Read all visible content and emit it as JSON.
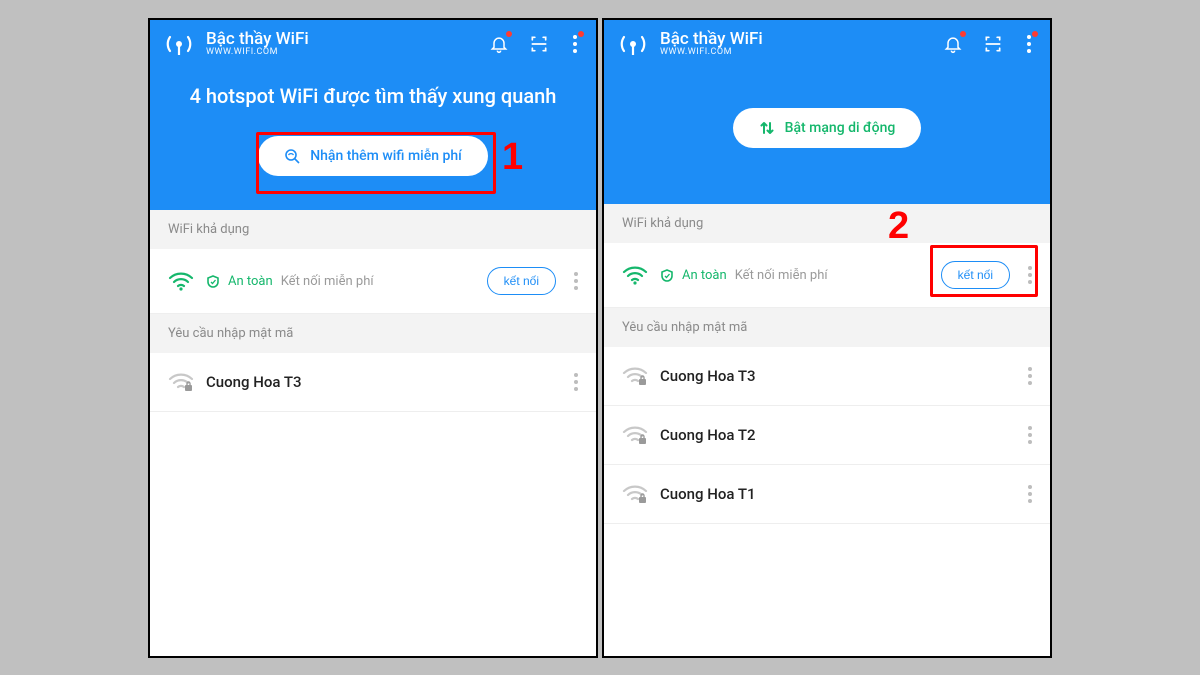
{
  "colors": {
    "primary": "#1d8df6",
    "success": "#15b76c",
    "danger": "#ff3b30"
  },
  "app": {
    "title": "Bậc thầy WiFi",
    "subtitle": "WWW.WIFI.COM"
  },
  "left": {
    "hero_headline": "4 hotspot WiFi được tìm thấy xung quanh",
    "pill_label": "Nhận thêm wifi miễn phí",
    "section_available": "WiFi khả dụng",
    "safe": "An toàn",
    "free_connect": "Kết nối miễn phí",
    "connect_btn": "kết nối",
    "section_password": "Yêu cầu nhập mật mã",
    "networks": [
      {
        "name": "Cuong Hoa T3"
      }
    ],
    "annot_number": "1"
  },
  "right": {
    "pill_label": "Bật mạng di động",
    "section_available": "WiFi khả dụng",
    "safe": "An toàn",
    "free_connect": "Kết nối miễn phí",
    "connect_btn": "kết nối",
    "section_password": "Yêu cầu nhập mật mã",
    "networks": [
      {
        "name": "Cuong Hoa T3"
      },
      {
        "name": "Cuong Hoa T2"
      },
      {
        "name": "Cuong Hoa T1"
      }
    ],
    "annot_number": "2"
  }
}
